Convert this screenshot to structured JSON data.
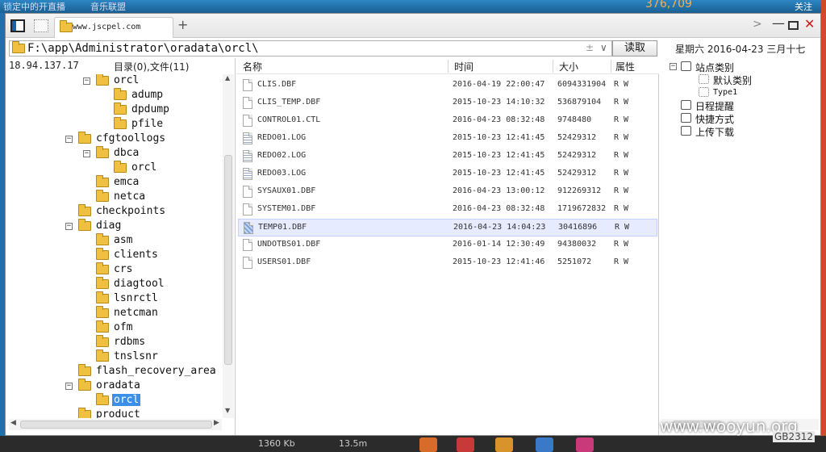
{
  "background": {
    "top_left_text": "锁定中的开直播",
    "top_mid_text": "音乐联盟",
    "top_right_number": "376,709",
    "top_far_right": "关注",
    "bottom_texts": [
      "1360 Kb",
      "13.5m"
    ]
  },
  "tabbar": {
    "tab_title": "www.jscpel.com",
    "add_label": "+",
    "nav_label": ">",
    "min_label": "—",
    "close_label": "✕"
  },
  "address": {
    "path": "F:\\app\\Administrator\\oradata\\orcl\\",
    "pm": "±",
    "dd": "∨",
    "read_button": "读取",
    "date_text": "星期六 2016-04-23 三月十七"
  },
  "left": {
    "ip": "18.94.137.17",
    "info": "目录(0),文件(11)",
    "tree": [
      {
        "label": "orcl",
        "level": 2,
        "exp": "−"
      },
      {
        "label": "adump",
        "level": 3,
        "exp": ""
      },
      {
        "label": "dpdump",
        "level": 3,
        "exp": ""
      },
      {
        "label": "pfile",
        "level": 3,
        "exp": ""
      },
      {
        "label": "cfgtoollogs",
        "level": 1,
        "exp": "−"
      },
      {
        "label": "dbca",
        "level": 2,
        "exp": "−"
      },
      {
        "label": "orcl",
        "level": 3,
        "exp": ""
      },
      {
        "label": "emca",
        "level": 2,
        "exp": ""
      },
      {
        "label": "netca",
        "level": 2,
        "exp": ""
      },
      {
        "label": "checkpoints",
        "level": 1,
        "exp": ""
      },
      {
        "label": "diag",
        "level": 1,
        "exp": "−"
      },
      {
        "label": "asm",
        "level": 2,
        "exp": ""
      },
      {
        "label": "clients",
        "level": 2,
        "exp": ""
      },
      {
        "label": "crs",
        "level": 2,
        "exp": ""
      },
      {
        "label": "diagtool",
        "level": 2,
        "exp": ""
      },
      {
        "label": "lsnrctl",
        "level": 2,
        "exp": ""
      },
      {
        "label": "netcman",
        "level": 2,
        "exp": ""
      },
      {
        "label": "ofm",
        "level": 2,
        "exp": ""
      },
      {
        "label": "rdbms",
        "level": 2,
        "exp": ""
      },
      {
        "label": "tnslsnr",
        "level": 2,
        "exp": ""
      },
      {
        "label": "flash_recovery_area",
        "level": 1,
        "exp": ""
      },
      {
        "label": "oradata",
        "level": 1,
        "exp": "−"
      },
      {
        "label": "orcl",
        "level": 2,
        "exp": "",
        "selected": true
      },
      {
        "label": "product",
        "level": 1,
        "exp": ""
      }
    ]
  },
  "files": {
    "columns": [
      "名称",
      "时间",
      "大小",
      "属性"
    ],
    "rows": [
      {
        "name": "CLIS.DBF",
        "time": "2016-04-19 22:00:47",
        "size": "6094331904",
        "attr": "R W",
        "kind": "doc"
      },
      {
        "name": "CLIS_TEMP.DBF",
        "time": "2015-10-23 14:10:32",
        "size": "536879104",
        "attr": "R W",
        "kind": "doc"
      },
      {
        "name": "CONTROL01.CTL",
        "time": "2016-04-23 08:32:48",
        "size": "9748480",
        "attr": "R W",
        "kind": "doc"
      },
      {
        "name": "REDO01.LOG",
        "time": "2015-10-23 12:41:45",
        "size": "52429312",
        "attr": "R W",
        "kind": "log"
      },
      {
        "name": "REDO02.LOG",
        "time": "2015-10-23 12:41:45",
        "size": "52429312",
        "attr": "R W",
        "kind": "log"
      },
      {
        "name": "REDO03.LOG",
        "time": "2015-10-23 12:41:45",
        "size": "52429312",
        "attr": "R W",
        "kind": "log"
      },
      {
        "name": "SYSAUX01.DBF",
        "time": "2016-04-23 13:00:12",
        "size": "912269312",
        "attr": "R W",
        "kind": "doc"
      },
      {
        "name": "SYSTEM01.DBF",
        "time": "2016-04-23 08:32:48",
        "size": "1719672832",
        "attr": "R W",
        "kind": "doc"
      },
      {
        "name": "TEMP01.DBF",
        "time": "2016-04-23 14:04:23",
        "size": "30416896",
        "attr": "R W",
        "kind": "sel",
        "selected": true
      },
      {
        "name": "UNDOTBS01.DBF",
        "time": "2016-01-14 12:30:49",
        "size": "94380032",
        "attr": "R W",
        "kind": "doc"
      },
      {
        "name": "USERS01.DBF",
        "time": "2015-10-23 12:41:46",
        "size": "5251072",
        "attr": "R W",
        "kind": "doc"
      }
    ]
  },
  "right": {
    "items": [
      {
        "label": "站点类别",
        "exp": "−",
        "icon": "category-icon",
        "indent": 0
      },
      {
        "label": "默认类别",
        "exp": "",
        "icon": "dotted-box-icon",
        "indent": 1
      },
      {
        "label": "Type1",
        "exp": "",
        "icon": "dotted-box-icon",
        "indent": 1,
        "small": true
      },
      {
        "label": "日程提醒",
        "exp": "",
        "icon": "schedule-icon",
        "indent": 0
      },
      {
        "label": "快捷方式",
        "exp": "",
        "icon": "hand-icon",
        "indent": 0
      },
      {
        "label": "上传下载",
        "exp": "",
        "icon": "transfer-icon",
        "indent": 0
      }
    ]
  },
  "watermark": "www.wooyun.org",
  "encoding": "GB2312",
  "colors": {
    "selection": "#3a8fe8",
    "row_selection": "#e6ebff",
    "folder": "#f0c040",
    "close_red": "#d01818"
  }
}
